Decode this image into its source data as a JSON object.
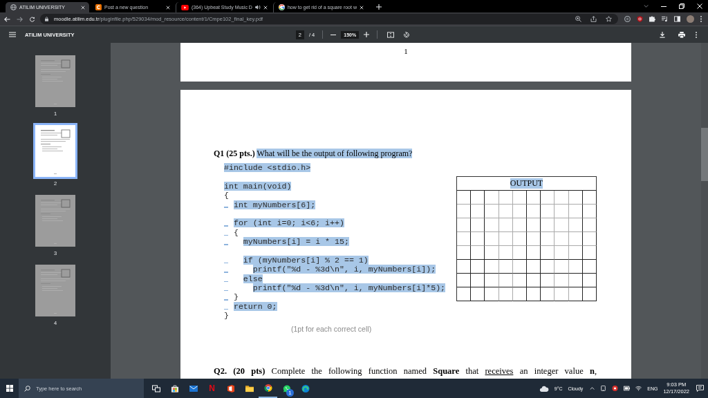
{
  "browser": {
    "tabs": [
      {
        "title": "ATILIM UNIVERSITY",
        "kind": "globe",
        "selected": true,
        "audio": false
      },
      {
        "title": "Post a new question",
        "kind": "chegg",
        "selected": false,
        "audio": false
      },
      {
        "title": "(364) Upbeat Study Music D",
        "kind": "youtube",
        "selected": false,
        "audio": true
      },
      {
        "title": "how to get rid of a square root w",
        "kind": "google",
        "selected": false,
        "audio": false
      }
    ],
    "address": {
      "host": "moodle.atilim.edu.tr",
      "path": "/pluginfile.php/529034/mod_resource/content/1/Cmpe102_final_key.pdf"
    }
  },
  "pdf_toolbar": {
    "title": "ATILIM UNIVERSITY",
    "page": "2",
    "page_count": "/ 4",
    "zoom": "150%"
  },
  "thumbnails": [
    {
      "label": "1",
      "selected": false
    },
    {
      "label": "2",
      "selected": true
    },
    {
      "label": "3",
      "selected": false
    },
    {
      "label": "4",
      "selected": false
    }
  ],
  "page_1": {
    "page_number": "1"
  },
  "page_2": {
    "question_1": {
      "number": "Q1 (25 pts.)",
      "prompt": "What will be the output of following program?",
      "highlighted": true
    },
    "code_blocks": [
      {
        "lines": [
          {
            "text": "#include <stdio.h>",
            "highlighted": true,
            "marked": false
          }
        ]
      },
      {
        "lines": [
          {
            "text": "int main(void)",
            "highlighted": true,
            "marked": false
          },
          {
            "text": "{",
            "highlighted": false,
            "marked": false
          },
          {
            "text": "  int myNumbers[6];",
            "highlighted": true,
            "marked": true
          }
        ]
      },
      {
        "lines": [
          {
            "text": "  for (int i=0; i<6; i++)",
            "highlighted": true,
            "marked": true
          },
          {
            "text": "  {",
            "highlighted": false,
            "marked": true
          },
          {
            "text": "    myNumbers[i] = i * 15;",
            "highlighted": true,
            "marked": true
          }
        ]
      },
      {
        "lines": [
          {
            "text": "    if (myNumbers[i] % 2 == 1)",
            "highlighted": true,
            "marked": true
          },
          {
            "text": "      printf(\"%d - %3d\\n\", i, myNumbers[i]);",
            "highlighted": true,
            "marked": true
          },
          {
            "text": "    else",
            "highlighted": true,
            "marked": true
          },
          {
            "text": "      printf(\"%d - %3d\\n\", i, myNumbers[i]*5);",
            "highlighted": true,
            "marked": true
          },
          {
            "text": "  }",
            "highlighted": false,
            "marked": true
          },
          {
            "text": "  return 0;",
            "highlighted": true,
            "marked": true
          },
          {
            "text": "}",
            "highlighted": false,
            "marked": false
          }
        ]
      }
    ],
    "output_table": {
      "header": "OUTPUT",
      "highlighted": true
    },
    "note": "(1pt for each correct cell)",
    "question_2": [
      {
        "kind": "bold",
        "text": "Q2. (20 pts)"
      },
      {
        "kind": "plain",
        "text": " Complete the following function named "
      },
      {
        "kind": "bold",
        "text": "Square"
      },
      {
        "kind": "plain",
        "text": " that "
      },
      {
        "kind": "underline",
        "text": "receives"
      },
      {
        "kind": "plain",
        "text": " an integer value "
      },
      {
        "kind": "bold",
        "text": "n"
      },
      {
        "kind": "plain",
        "text": ","
      }
    ]
  },
  "taskbar": {
    "search": {
      "placeholder": "Type here to search"
    },
    "apps": [
      {
        "kind": "task_view",
        "running": false
      },
      {
        "kind": "store",
        "running": false
      },
      {
        "kind": "mail",
        "running": false
      },
      {
        "kind": "netflix",
        "glyph": "N",
        "running": false
      },
      {
        "kind": "office",
        "running": false
      },
      {
        "kind": "explorer",
        "running": false
      },
      {
        "kind": "chrome",
        "running": true
      },
      {
        "kind": "whatsapp",
        "running": false,
        "badge": "1"
      },
      {
        "kind": "edge",
        "running": false
      }
    ],
    "weather": {
      "temperature": "9°C",
      "condition": "Cloudy"
    },
    "language": "ENG",
    "time": "9:03 PM",
    "date": "12/17/2022"
  }
}
